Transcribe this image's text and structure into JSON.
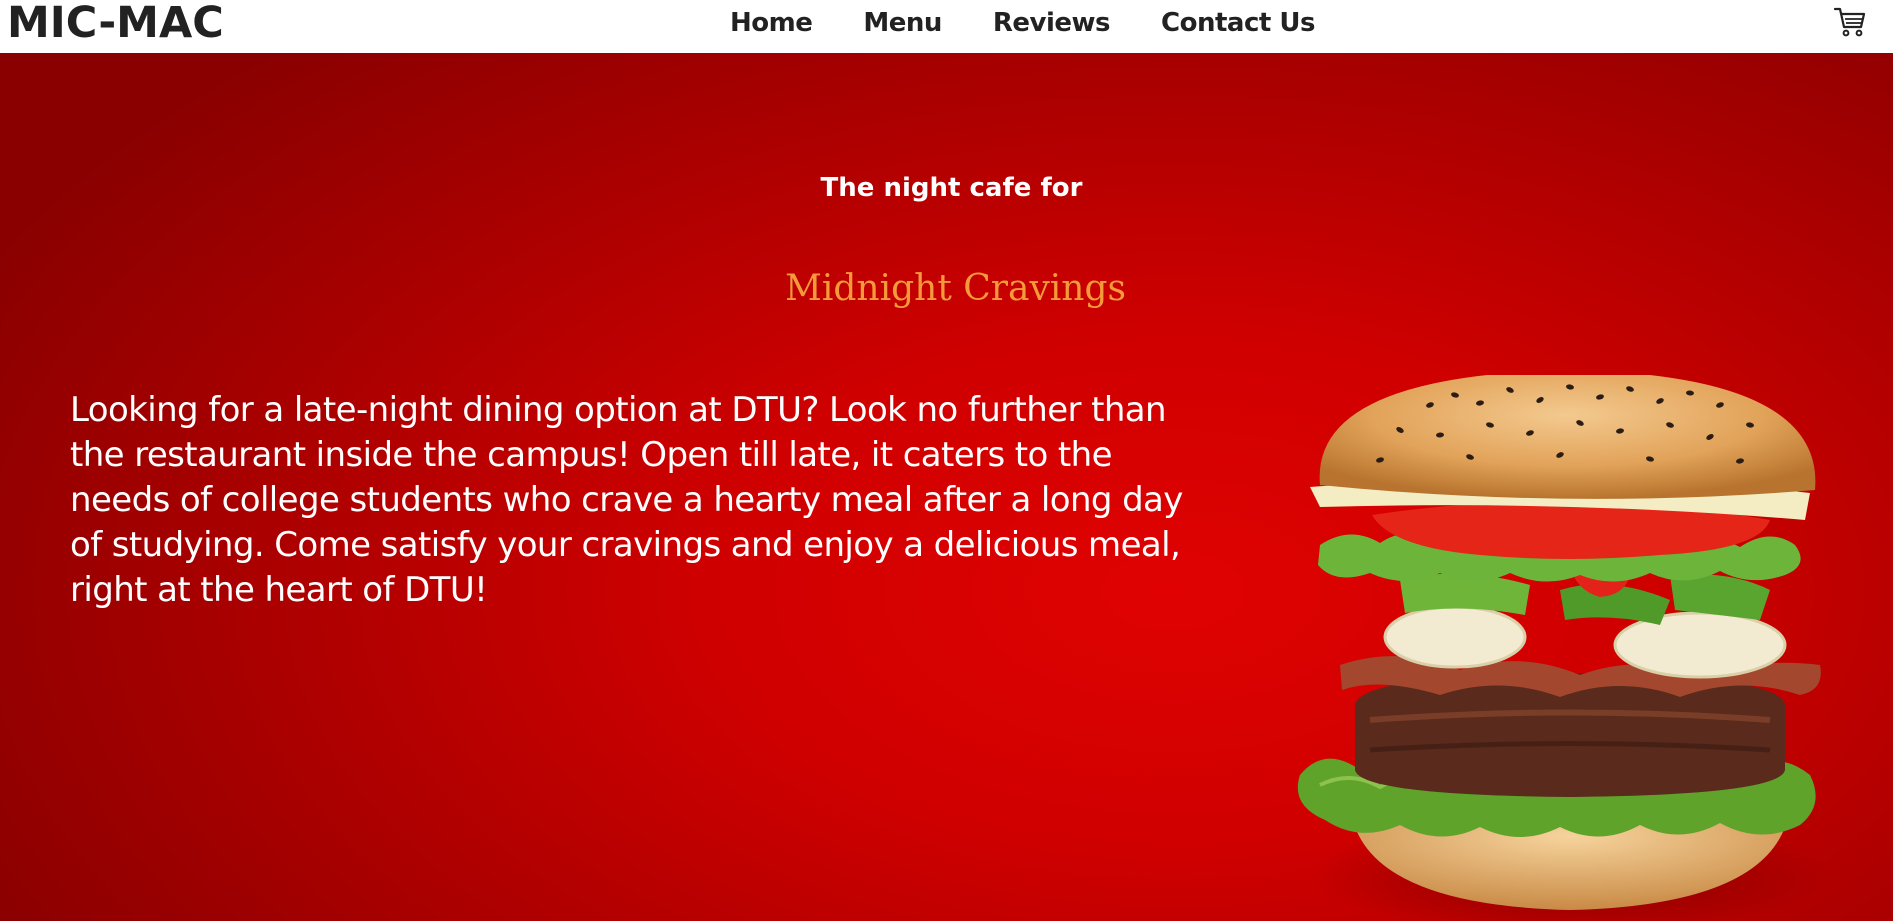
{
  "navbar": {
    "brand": "MIC-MAC",
    "links": [
      "Home",
      "Menu",
      "Reviews",
      "Contact Us"
    ]
  },
  "icons": {
    "cart": "cart-icon"
  },
  "hero": {
    "tagline": "The night cafe for",
    "headline": "Midnight Cravings",
    "description": "Looking for a late-night dining option at DTU? Look no further than the restaurant inside the campus! Open till late, it caters to the needs of college students who crave a hearty meal after a long day of studying. Come satisfy your cravings and enjoy a delicious meal, right at the heart of DTU!",
    "image": "burger-image"
  },
  "colors": {
    "hero_background": "#cf0000",
    "headline": "#f59a3a",
    "nav_text": "#222222"
  }
}
